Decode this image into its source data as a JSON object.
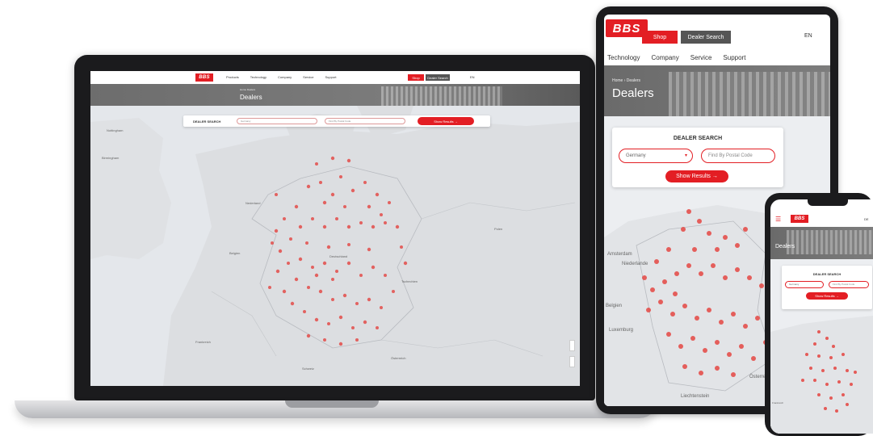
{
  "brand": {
    "logo_text": "BBS",
    "accent": "#e31e24",
    "dark": "#1b1b1d"
  },
  "laptop": {
    "nav": {
      "links": [
        "Products",
        "Technology",
        "Company",
        "Service",
        "Support"
      ],
      "shop": "Shop",
      "dealer_search": "Dealer Search",
      "lang": "EN"
    },
    "breadcrumb": "Home  Dealers",
    "title": "Dealers",
    "search": {
      "label": "DEALER SEARCH",
      "country": "Germany",
      "postal_placeholder": "Find By Postal Code",
      "button": "Show Results"
    },
    "map_labels": [
      "Nottingham",
      "Birmingham",
      "Nederland",
      "Belgien",
      "Deutschland",
      "Tschechien",
      "Österreich",
      "Schweiz",
      "Frankreich",
      "Polen"
    ]
  },
  "tablet": {
    "nav": {
      "shop": "Shop",
      "dealer_search": "Dealer Search",
      "lang": "EN",
      "links": [
        "Technology",
        "Company",
        "Service",
        "Support"
      ]
    },
    "breadcrumb": "Home  ›  Dealers",
    "title": "Dealers",
    "search": {
      "label": "DEALER SEARCH",
      "country": "Germany",
      "postal_placeholder": "Find By Postal Code",
      "button": "Show Results"
    },
    "map_labels": [
      "Amsterdam",
      "Niederlande",
      "Belgien",
      "Luxemburg",
      "Österreich",
      "Liechtenstein"
    ]
  },
  "phone": {
    "lang": "DE",
    "title": "Dealers",
    "search": {
      "label": "DEALER SEARCH",
      "country": "Germany",
      "postal_placeholder": "Find By Postal Code",
      "button": "Show Results"
    },
    "map_labels": [
      "Frankreich"
    ]
  }
}
